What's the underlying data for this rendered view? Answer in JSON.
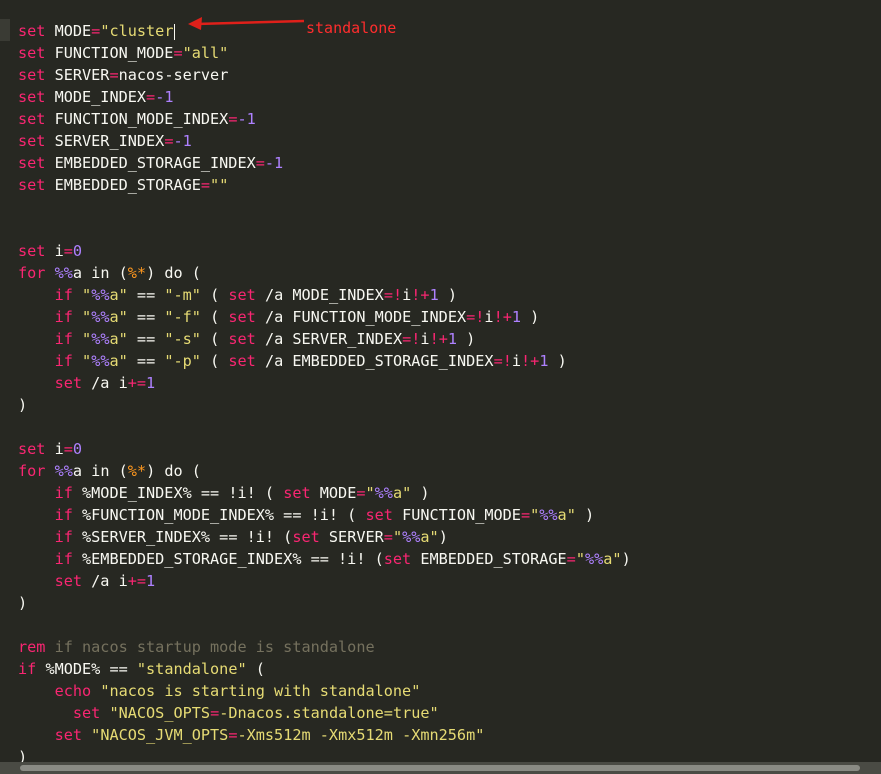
{
  "annotation": {
    "text": "standalone",
    "color": "#ff2d2d"
  },
  "editor": {
    "theme": {
      "background": "#272822",
      "keyword": "#f92672",
      "string": "#e6db74",
      "number": "#ae81ff",
      "comment": "#75715e",
      "text": "#f8f8f2"
    },
    "lines": [
      [
        {
          "t": "set",
          "c": "kw"
        },
        {
          "t": " MODE"
        },
        {
          "t": "=",
          "c": "op"
        },
        {
          "t": "\"cluster",
          "c": "str"
        },
        {
          "cursor": true
        }
      ],
      [
        {
          "t": "set",
          "c": "kw"
        },
        {
          "t": " FUNCTION_MODE"
        },
        {
          "t": "=",
          "c": "op"
        },
        {
          "t": "\"all\"",
          "c": "str"
        }
      ],
      [
        {
          "t": "set",
          "c": "kw"
        },
        {
          "t": " SERVER"
        },
        {
          "t": "=",
          "c": "op"
        },
        {
          "t": "nacos-server"
        }
      ],
      [
        {
          "t": "set",
          "c": "kw"
        },
        {
          "t": " MODE_INDEX"
        },
        {
          "t": "=",
          "c": "op"
        },
        {
          "t": "-1",
          "c": "num"
        }
      ],
      [
        {
          "t": "set",
          "c": "kw"
        },
        {
          "t": " FUNCTION_MODE_INDEX"
        },
        {
          "t": "=",
          "c": "op"
        },
        {
          "t": "-1",
          "c": "num"
        }
      ],
      [
        {
          "t": "set",
          "c": "kw"
        },
        {
          "t": " SERVER_INDEX"
        },
        {
          "t": "=",
          "c": "op"
        },
        {
          "t": "-1",
          "c": "num"
        }
      ],
      [
        {
          "t": "set",
          "c": "kw"
        },
        {
          "t": " EMBEDDED_STORAGE_INDEX"
        },
        {
          "t": "=",
          "c": "op"
        },
        {
          "t": "-1",
          "c": "num"
        }
      ],
      [
        {
          "t": "set",
          "c": "kw"
        },
        {
          "t": " EMBEDDED_STORAGE"
        },
        {
          "t": "=",
          "c": "op"
        },
        {
          "t": "\"\"",
          "c": "str"
        }
      ],
      [],
      [],
      [
        {
          "t": "set",
          "c": "kw"
        },
        {
          "t": " i"
        },
        {
          "t": "=",
          "c": "op"
        },
        {
          "t": "0",
          "c": "num"
        }
      ],
      [
        {
          "t": "for",
          "c": "kw"
        },
        {
          "t": " "
        },
        {
          "t": "%%",
          "c": "num"
        },
        {
          "t": "a in ("
        },
        {
          "t": "%*",
          "c": "pct"
        },
        {
          "t": ") do ("
        }
      ],
      [
        {
          "t": "    "
        },
        {
          "t": "if",
          "c": "kw"
        },
        {
          "t": " "
        },
        {
          "t": "\"",
          "c": "str"
        },
        {
          "t": "%%",
          "c": "num"
        },
        {
          "t": "a\"",
          "c": "str"
        },
        {
          "t": " == "
        },
        {
          "t": "\"-m\"",
          "c": "str"
        },
        {
          "t": " ( "
        },
        {
          "t": "set",
          "c": "kw"
        },
        {
          "t": " /a MODE_INDEX"
        },
        {
          "t": "=!",
          "c": "op"
        },
        {
          "t": "i"
        },
        {
          "t": "!+",
          "c": "op"
        },
        {
          "t": "1",
          "c": "num"
        },
        {
          "t": " )"
        }
      ],
      [
        {
          "t": "    "
        },
        {
          "t": "if",
          "c": "kw"
        },
        {
          "t": " "
        },
        {
          "t": "\"",
          "c": "str"
        },
        {
          "t": "%%",
          "c": "num"
        },
        {
          "t": "a\"",
          "c": "str"
        },
        {
          "t": " == "
        },
        {
          "t": "\"-f\"",
          "c": "str"
        },
        {
          "t": " ( "
        },
        {
          "t": "set",
          "c": "kw"
        },
        {
          "t": " /a FUNCTION_MODE_INDEX"
        },
        {
          "t": "=!",
          "c": "op"
        },
        {
          "t": "i"
        },
        {
          "t": "!+",
          "c": "op"
        },
        {
          "t": "1",
          "c": "num"
        },
        {
          "t": " )"
        }
      ],
      [
        {
          "t": "    "
        },
        {
          "t": "if",
          "c": "kw"
        },
        {
          "t": " "
        },
        {
          "t": "\"",
          "c": "str"
        },
        {
          "t": "%%",
          "c": "num"
        },
        {
          "t": "a\"",
          "c": "str"
        },
        {
          "t": " == "
        },
        {
          "t": "\"-s\"",
          "c": "str"
        },
        {
          "t": " ( "
        },
        {
          "t": "set",
          "c": "kw"
        },
        {
          "t": " /a SERVER_INDEX"
        },
        {
          "t": "=!",
          "c": "op"
        },
        {
          "t": "i"
        },
        {
          "t": "!+",
          "c": "op"
        },
        {
          "t": "1",
          "c": "num"
        },
        {
          "t": " )"
        }
      ],
      [
        {
          "t": "    "
        },
        {
          "t": "if",
          "c": "kw"
        },
        {
          "t": " "
        },
        {
          "t": "\"",
          "c": "str"
        },
        {
          "t": "%%",
          "c": "num"
        },
        {
          "t": "a\"",
          "c": "str"
        },
        {
          "t": " == "
        },
        {
          "t": "\"-p\"",
          "c": "str"
        },
        {
          "t": " ( "
        },
        {
          "t": "set",
          "c": "kw"
        },
        {
          "t": " /a EMBEDDED_STORAGE_INDEX"
        },
        {
          "t": "=!",
          "c": "op"
        },
        {
          "t": "i"
        },
        {
          "t": "!+",
          "c": "op"
        },
        {
          "t": "1",
          "c": "num"
        },
        {
          "t": " )"
        }
      ],
      [
        {
          "t": "    "
        },
        {
          "t": "set",
          "c": "kw"
        },
        {
          "t": " /a i"
        },
        {
          "t": "+=",
          "c": "op"
        },
        {
          "t": "1",
          "c": "num"
        }
      ],
      [
        {
          "t": ")"
        }
      ],
      [],
      [
        {
          "t": "set",
          "c": "kw"
        },
        {
          "t": " i"
        },
        {
          "t": "=",
          "c": "op"
        },
        {
          "t": "0",
          "c": "num"
        }
      ],
      [
        {
          "t": "for",
          "c": "kw"
        },
        {
          "t": " "
        },
        {
          "t": "%%",
          "c": "num"
        },
        {
          "t": "a in ("
        },
        {
          "t": "%*",
          "c": "pct"
        },
        {
          "t": ") do ("
        }
      ],
      [
        {
          "t": "    "
        },
        {
          "t": "if",
          "c": "kw"
        },
        {
          "t": " %MODE_INDEX% == !i! ( "
        },
        {
          "t": "set",
          "c": "kw"
        },
        {
          "t": " MODE"
        },
        {
          "t": "=",
          "c": "op"
        },
        {
          "t": "\"",
          "c": "str"
        },
        {
          "t": "%%",
          "c": "num"
        },
        {
          "t": "a\"",
          "c": "str"
        },
        {
          "t": " )"
        }
      ],
      [
        {
          "t": "    "
        },
        {
          "t": "if",
          "c": "kw"
        },
        {
          "t": " %FUNCTION_MODE_INDEX% == !i! ( "
        },
        {
          "t": "set",
          "c": "kw"
        },
        {
          "t": " FUNCTION_MODE"
        },
        {
          "t": "=",
          "c": "op"
        },
        {
          "t": "\"",
          "c": "str"
        },
        {
          "t": "%%",
          "c": "num"
        },
        {
          "t": "a\"",
          "c": "str"
        },
        {
          "t": " )"
        }
      ],
      [
        {
          "t": "    "
        },
        {
          "t": "if",
          "c": "kw"
        },
        {
          "t": " %SERVER_INDEX% == !i! ("
        },
        {
          "t": "set",
          "c": "kw"
        },
        {
          "t": " SERVER"
        },
        {
          "t": "=",
          "c": "op"
        },
        {
          "t": "\"",
          "c": "str"
        },
        {
          "t": "%%",
          "c": "num"
        },
        {
          "t": "a\"",
          "c": "str"
        },
        {
          "t": ")"
        }
      ],
      [
        {
          "t": "    "
        },
        {
          "t": "if",
          "c": "kw"
        },
        {
          "t": " %EMBEDDED_STORAGE_INDEX% == !i! ("
        },
        {
          "t": "set",
          "c": "kw"
        },
        {
          "t": " EMBEDDED_STORAGE"
        },
        {
          "t": "=",
          "c": "op"
        },
        {
          "t": "\"",
          "c": "str"
        },
        {
          "t": "%%",
          "c": "num"
        },
        {
          "t": "a\"",
          "c": "str"
        },
        {
          "t": ")"
        }
      ],
      [
        {
          "t": "    "
        },
        {
          "t": "set",
          "c": "kw"
        },
        {
          "t": " /a i"
        },
        {
          "t": "+=",
          "c": "op"
        },
        {
          "t": "1",
          "c": "num"
        }
      ],
      [
        {
          "t": ")"
        }
      ],
      [],
      [
        {
          "t": "rem",
          "c": "kw"
        },
        {
          "t": " if nacos startup mode is standalone",
          "c": "cmt"
        }
      ],
      [
        {
          "t": "if",
          "c": "kw"
        },
        {
          "t": " %MODE% == "
        },
        {
          "t": "\"standalone\"",
          "c": "str"
        },
        {
          "t": " ("
        }
      ],
      [
        {
          "t": "    "
        },
        {
          "t": "echo",
          "c": "kw"
        },
        {
          "t": " "
        },
        {
          "t": "\"nacos is starting with standalone\"",
          "c": "str"
        }
      ],
      [
        {
          "t": "      "
        },
        {
          "t": "set",
          "c": "kw"
        },
        {
          "t": " "
        },
        {
          "t": "\"NACOS_OPTS",
          "c": "str"
        },
        {
          "t": "=",
          "c": "op"
        },
        {
          "t": "-Dnacos.standalone=true\"",
          "c": "str"
        }
      ],
      [
        {
          "t": "    "
        },
        {
          "t": "set",
          "c": "kw"
        },
        {
          "t": " "
        },
        {
          "t": "\"NACOS_JVM_OPTS",
          "c": "str"
        },
        {
          "t": "=",
          "c": "op"
        },
        {
          "t": "-Xms512m -Xmx512m -Xmn256m\"",
          "c": "str"
        }
      ],
      [
        {
          "t": ")"
        }
      ]
    ]
  }
}
